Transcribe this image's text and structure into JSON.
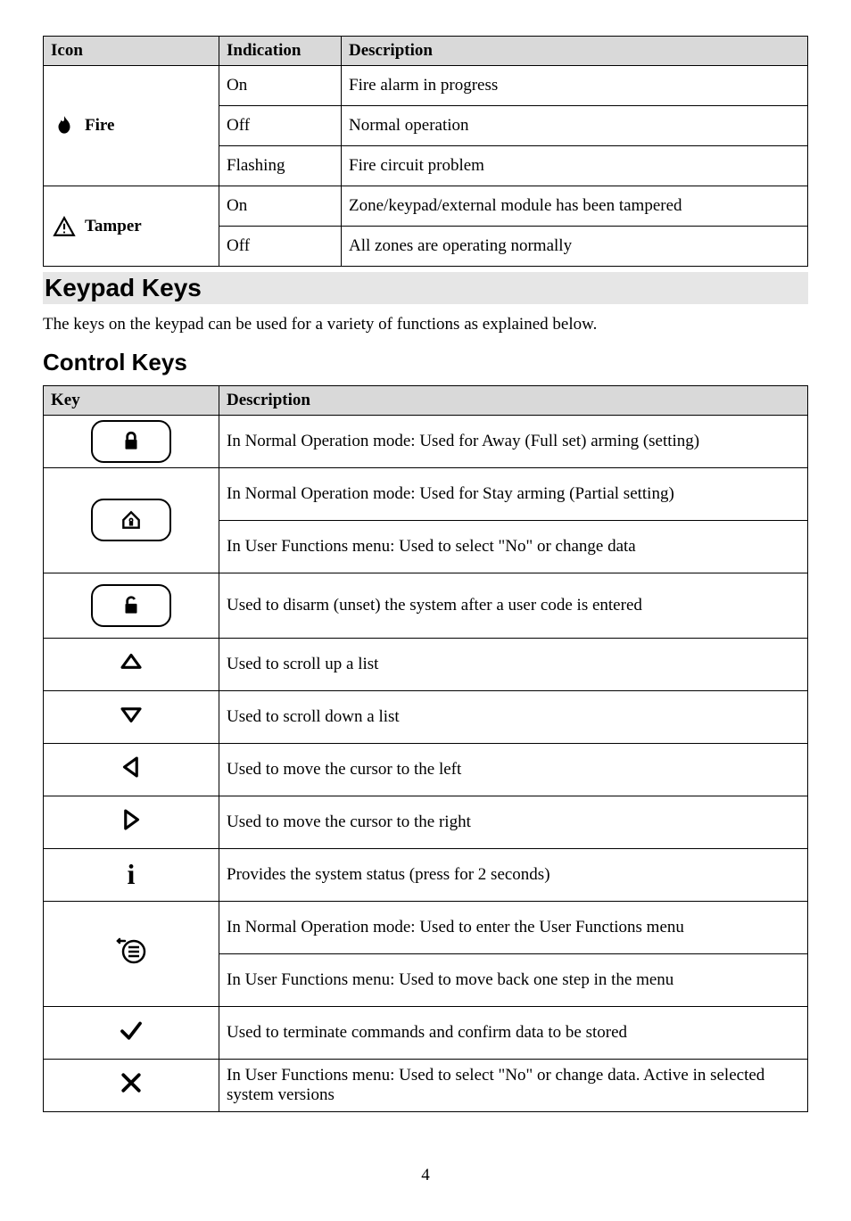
{
  "iconTable": {
    "headers": [
      "Icon",
      "Indication",
      "Description"
    ],
    "rows": [
      {
        "iconLabel": "Fire",
        "indication": "On",
        "description": "Fire alarm in progress"
      },
      {
        "iconLabel": "Fire",
        "indication": "Off",
        "description": "Normal operation"
      },
      {
        "iconLabel": "Fire",
        "indication": "Flashing",
        "description": "Fire circuit problem"
      },
      {
        "iconLabel": "Tamper",
        "indication": "On",
        "description": "Zone/keypad/external module has been tampered"
      },
      {
        "iconLabel": "Tamper",
        "indication": "Off",
        "description": "All zones are operating normally"
      }
    ]
  },
  "sections": {
    "keypadKeysTitle": "Keypad Keys",
    "keypadKeysBody": "The keys on the keypad can be used for a variety of functions as explained below.",
    "controlKeysTitle": "Control Keys"
  },
  "controlTable": {
    "headers": [
      "Key",
      "Description"
    ],
    "rows": [
      {
        "desc": "In Normal Operation mode: Used for Away (Full set) arming (setting)"
      },
      {
        "desc1": "In Normal Operation mode: Used for Stay arming (Partial setting)",
        "desc2": "In User Functions menu: Used to select \"No\" or change data"
      },
      {
        "desc": "Used to disarm (unset) the system after a user code is entered"
      },
      {
        "desc": "Used to scroll up a list"
      },
      {
        "desc": "Used to scroll down a list"
      },
      {
        "desc": "Used to move the cursor to the left"
      },
      {
        "desc": "Used to move the cursor to the right"
      },
      {
        "desc": "Provides the system status (press for 2 seconds)"
      },
      {
        "desc1": "In Normal Operation mode: Used to enter the User Functions menu",
        "desc2": "In User Functions menu: Used to move back one step in the menu"
      },
      {
        "desc": "Used to terminate commands and confirm data to be stored"
      },
      {
        "desc": "In User Functions menu: Used to select \"No\" or change data. Active in selected system versions"
      }
    ]
  },
  "pageNumber": "4"
}
